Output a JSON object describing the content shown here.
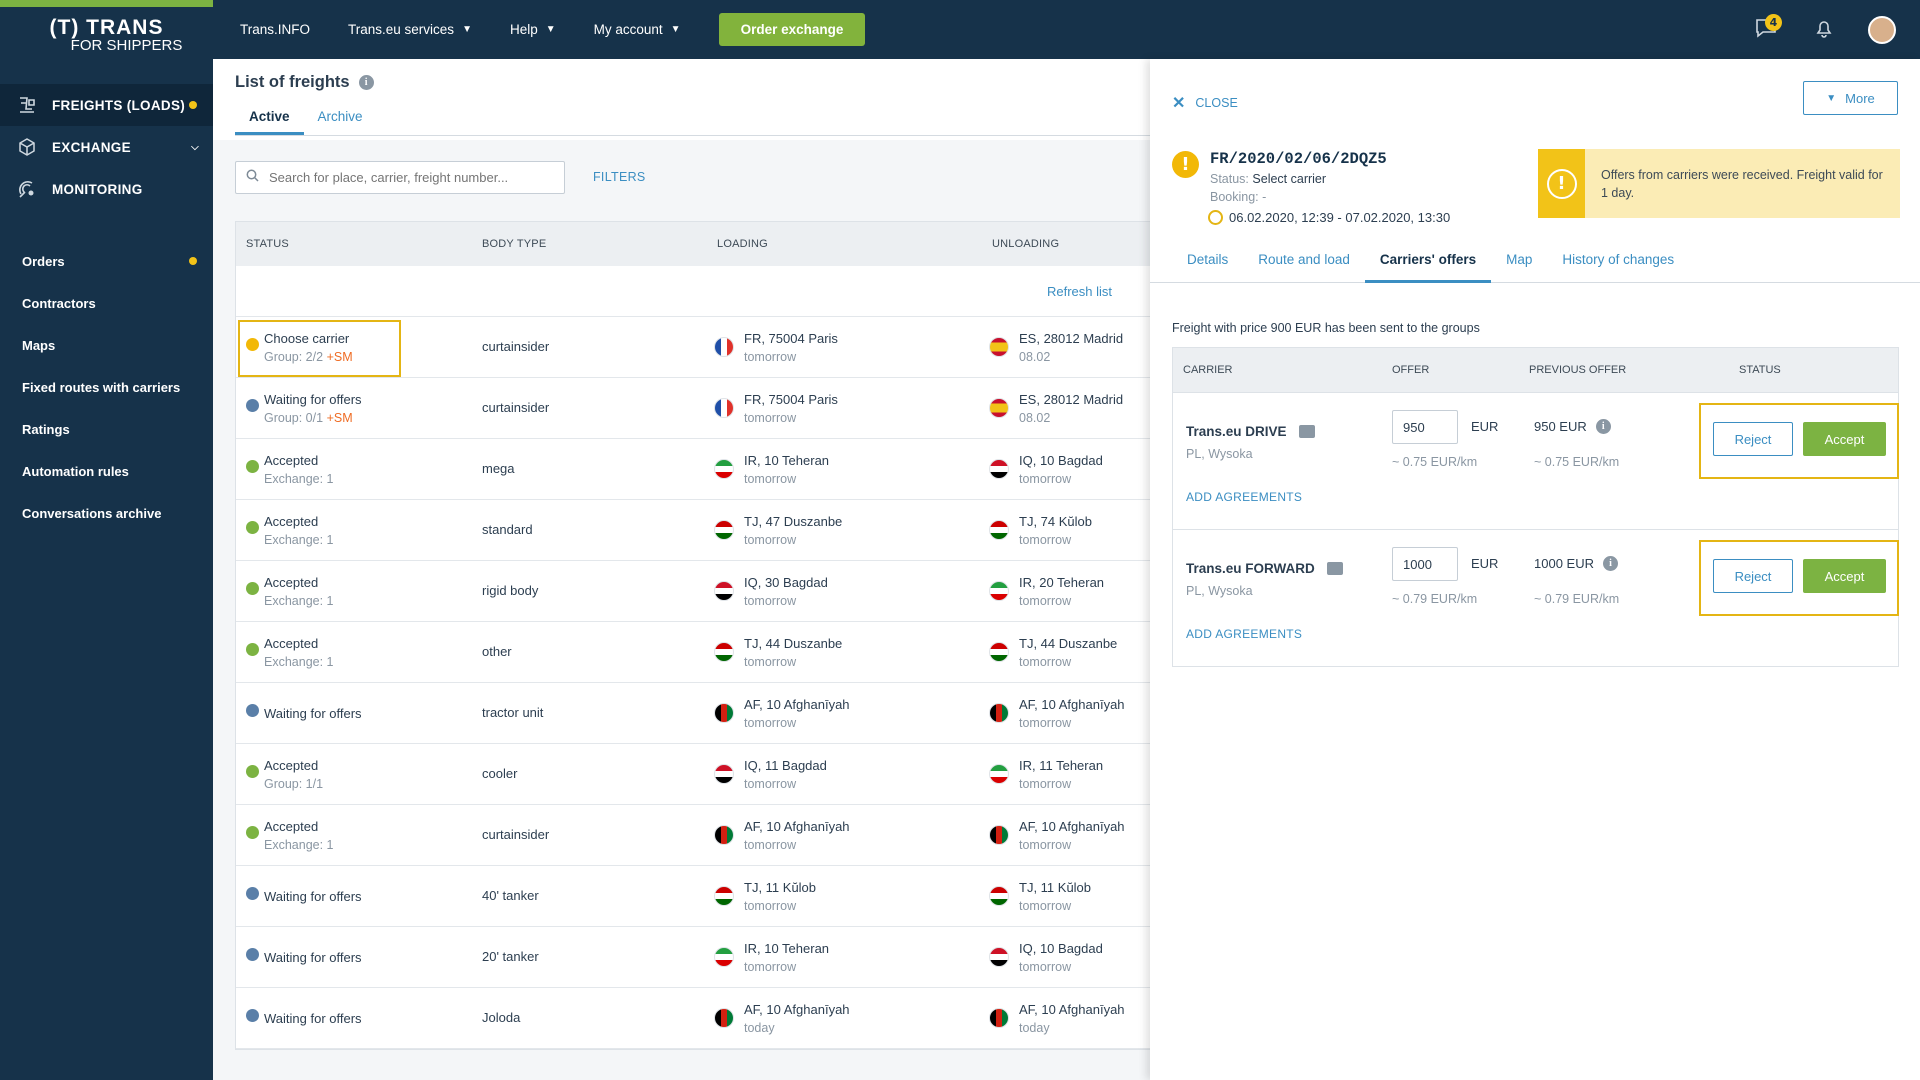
{
  "sidebar": {
    "logo_line1": "(T) TRANS",
    "logo_line2": "FOR SHIPPERS",
    "main": [
      {
        "label": "FREIGHTS (LOADS)",
        "icon": "freight-icon",
        "dot": true
      },
      {
        "label": "EXCHANGE",
        "icon": "box-icon",
        "chevron": true
      },
      {
        "label": "MONITORING",
        "icon": "satellite-icon"
      }
    ],
    "sub": [
      {
        "label": "Orders",
        "dot": true
      },
      {
        "label": "Contractors"
      },
      {
        "label": "Maps"
      },
      {
        "label": "Fixed routes with carriers"
      },
      {
        "label": "Ratings"
      },
      {
        "label": "Automation rules"
      },
      {
        "label": "Conversations archive"
      }
    ]
  },
  "topbar": {
    "links": [
      "Trans.INFO",
      "Trans.eu services",
      "Help",
      "My account"
    ],
    "order_button": "Order exchange",
    "messages_badge": "4"
  },
  "list": {
    "title": "List of freights",
    "tabs": [
      "Active",
      "Archive"
    ],
    "search_placeholder": "Search for place, carrier, freight number...",
    "filters": "FILTERS",
    "columns": [
      "STATUS",
      "BODY TYPE",
      "LOADING",
      "UNLOADING"
    ],
    "refresh": "Refresh list",
    "rows": [
      {
        "status": "Choose carrier",
        "sub": "Group: 2/2",
        "sm": "+SM",
        "kind": "warn",
        "body": "curtainsider",
        "load": "FR, 75004 Paris",
        "load_when": "tomorrow",
        "load_flag": "fr",
        "unload": "ES, 28012 Madrid",
        "unload_when": "08.02",
        "unload_flag": "es"
      },
      {
        "status": "Waiting for offers",
        "sub": "Group: 0/1",
        "sm": "+SM",
        "kind": "wait",
        "body": "curtainsider",
        "load": "FR, 75004 Paris",
        "load_when": "tomorrow",
        "load_flag": "fr",
        "unload": "ES, 28012 Madrid",
        "unload_when": "08.02",
        "unload_flag": "es"
      },
      {
        "status": "Accepted",
        "sub": "Exchange: 1",
        "sm": "",
        "kind": "ok",
        "body": "mega",
        "load": "IR, 10 Teheran",
        "load_when": "tomorrow",
        "load_flag": "ir",
        "unload": "IQ, 10 Bagdad",
        "unload_when": "tomorrow",
        "unload_flag": "iq"
      },
      {
        "status": "Accepted",
        "sub": "Exchange: 1",
        "sm": "",
        "kind": "ok",
        "body": "standard",
        "load": "TJ, 47 Duszanbe",
        "load_when": "tomorrow",
        "load_flag": "tj",
        "unload": "TJ, 74 Kŭlob",
        "unload_when": "tomorrow",
        "unload_flag": "tj"
      },
      {
        "status": "Accepted",
        "sub": "Exchange: 1",
        "sm": "",
        "kind": "ok",
        "body": "rigid body",
        "load": "IQ, 30 Bagdad",
        "load_when": "tomorrow",
        "load_flag": "iq",
        "unload": "IR, 20 Teheran",
        "unload_when": "tomorrow",
        "unload_flag": "ir"
      },
      {
        "status": "Accepted",
        "sub": "Exchange: 1",
        "sm": "",
        "kind": "ok",
        "body": "other",
        "load": "TJ, 44 Duszanbe",
        "load_when": "tomorrow",
        "load_flag": "tj",
        "unload": "TJ, 44 Duszanbe",
        "unload_when": "tomorrow",
        "unload_flag": "tj"
      },
      {
        "status": "Waiting for offers",
        "sub": "",
        "sm": "",
        "kind": "wait",
        "body": "tractor unit",
        "load": "AF, 10 Afghanīyah",
        "load_when": "tomorrow",
        "load_flag": "af",
        "unload": "AF, 10 Afghanīyah",
        "unload_when": "tomorrow",
        "unload_flag": "af"
      },
      {
        "status": "Accepted",
        "sub": "Group: 1/1",
        "sm": "",
        "kind": "ok",
        "body": "cooler",
        "load": "IQ, 11 Bagdad",
        "load_when": "tomorrow",
        "load_flag": "iq",
        "unload": "IR, 11 Teheran",
        "unload_when": "tomorrow",
        "unload_flag": "ir"
      },
      {
        "status": "Accepted",
        "sub": "Exchange: 1",
        "sm": "",
        "kind": "ok",
        "body": "curtainsider",
        "load": "AF, 10 Afghanīyah",
        "load_when": "tomorrow",
        "load_flag": "af",
        "unload": "AF, 10 Afghanīyah",
        "unload_when": "tomorrow",
        "unload_flag": "af"
      },
      {
        "status": "Waiting for offers",
        "sub": "",
        "sm": "",
        "kind": "wait",
        "body": "40' tanker",
        "load": "TJ, 11 Kŭlob",
        "load_when": "tomorrow",
        "load_flag": "tj",
        "unload": "TJ, 11 Kŭlob",
        "unload_when": "tomorrow",
        "unload_flag": "tj"
      },
      {
        "status": "Waiting for offers",
        "sub": "",
        "sm": "",
        "kind": "wait",
        "body": "20' tanker",
        "load": "IR, 10 Teheran",
        "load_when": "tomorrow",
        "load_flag": "ir",
        "unload": "IQ, 10 Bagdad",
        "unload_when": "tomorrow",
        "unload_flag": "iq"
      },
      {
        "status": "Waiting for offers",
        "sub": "",
        "sm": "",
        "kind": "wait",
        "body": "Joloda",
        "load": "AF, 10 Afghanīyah",
        "load_when": "today",
        "load_flag": "af",
        "unload": "AF, 10 Afghanīyah",
        "unload_when": "today",
        "unload_flag": "af"
      }
    ]
  },
  "panel": {
    "close": "CLOSE",
    "more": "More",
    "freight_id": "FR/2020/02/06/2DQZ5",
    "status_label": "Status:",
    "status_value": "Select carrier",
    "booking": "Booking: -",
    "time": "06.02.2020, 12:39 - 07.02.2020, 13:30",
    "notice": "Offers from carriers were received. Freight valid for 1 day.",
    "tabs": [
      "Details",
      "Route and load",
      "Carriers' offers",
      "Map",
      "History of changes"
    ],
    "sent_text": "Freight with price 900 EUR has been sent to the groups",
    "columns": [
      "CARRIER",
      "OFFER",
      "PREVIOUS OFFER",
      "STATUS"
    ],
    "offers": [
      {
        "carrier": "Trans.eu DRIVE",
        "location": "PL, Wysoka",
        "offer": "950",
        "currency": "EUR",
        "per_km": "~ 0.75 EUR/km",
        "previous": "950 EUR",
        "previous_km": "~ 0.75 EUR/km",
        "agreements": "ADD AGREEMENTS",
        "reject": "Reject",
        "accept": "Accept"
      },
      {
        "carrier": "Trans.eu FORWARD",
        "location": "PL, Wysoka",
        "offer": "1000",
        "currency": "EUR",
        "per_km": "~ 0.79 EUR/km",
        "previous": "1000 EUR",
        "previous_km": "~ 0.79 EUR/km",
        "agreements": "ADD AGREEMENTS",
        "reject": "Reject",
        "accept": "Accept"
      }
    ]
  },
  "colors": {
    "navy": "#16324a",
    "accent": "#3b8ec2",
    "green": "#7cb342",
    "yellow": "#f2c318"
  }
}
